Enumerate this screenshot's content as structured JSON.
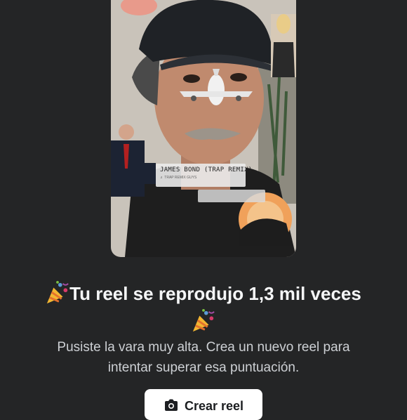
{
  "reel_preview": {
    "music_sticker": {
      "title": "JAMES BOND (TRAP REMIX)",
      "artist": "♬ TRAP REMIX GUYS"
    },
    "inset_label": "JAMES BOND TRAP REMIX"
  },
  "milestone": {
    "headline": "Tu reel se reprodujo 1,3 mil veces",
    "emoji_icon": "party-popper-icon",
    "description_line1": "Pusiste la vara muy alta. Crea un nuevo reel para",
    "description_line2": "intentar superar esa puntuación."
  },
  "actions": {
    "create_reel_label": "Crear reel",
    "create_reel_icon": "camera-icon"
  },
  "colors": {
    "background": "#242526",
    "text_primary": "#f5f6f7",
    "text_secondary": "#cdd0d4",
    "button_bg": "#ffffff"
  }
}
